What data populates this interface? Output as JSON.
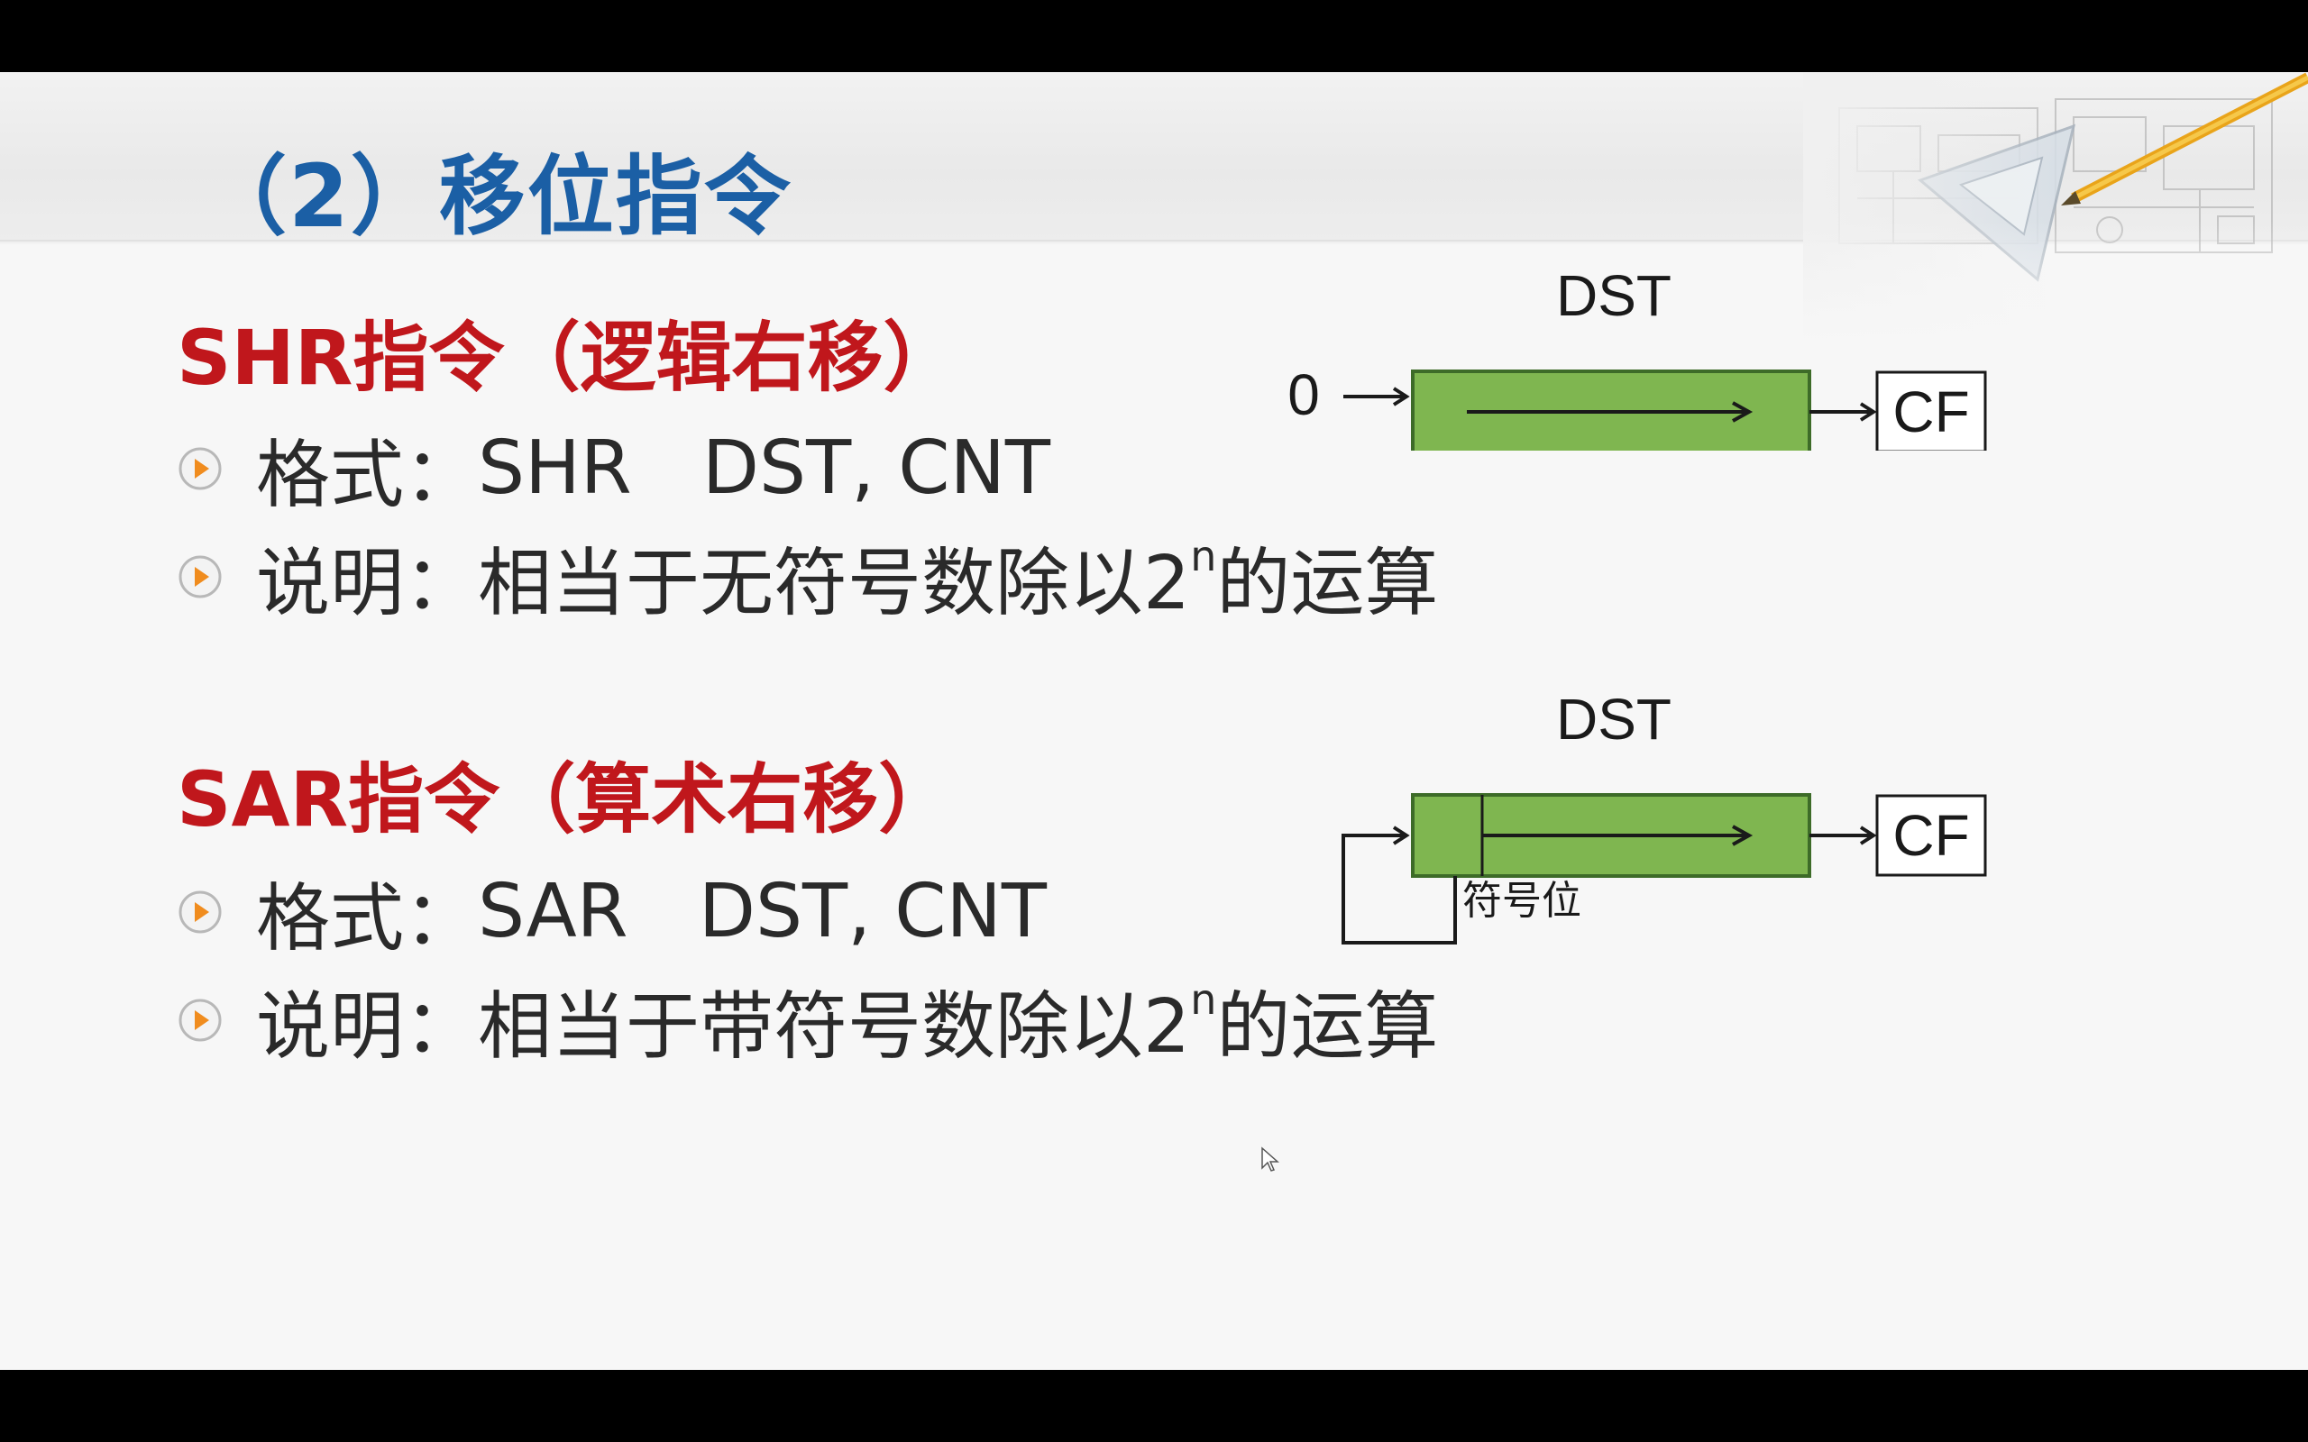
{
  "slide": {
    "title": "（2）移位指令",
    "sections": [
      {
        "heading": "SHR指令（逻辑右移）",
        "bullets": [
          {
            "label": "格式：",
            "text": "SHR   DST, CNT"
          },
          {
            "label": "说明：",
            "text": "相当于无符号数除以2",
            "sup": "n",
            "suffix": "的运算"
          }
        ],
        "diagram": {
          "register_label": "DST",
          "input_label": "0",
          "output_label": "CF"
        }
      },
      {
        "heading": "SAR指令（算术右移）",
        "bullets": [
          {
            "label": "格式：",
            "text": "SAR   DST, CNT"
          },
          {
            "label": "说明：",
            "text": "相当于带符号数除以2",
            "sup": "n",
            "suffix": "的运算"
          }
        ],
        "diagram": {
          "register_label": "DST",
          "output_label": "CF",
          "sign_bit_label": "符号位"
        }
      }
    ]
  },
  "colors": {
    "title": "#1b5fa5",
    "heading": "#c0171c",
    "register_fill": "#7fb650",
    "bullet_accent": "#f08c1e"
  },
  "icons": [
    "play-circle-bullet-icon",
    "pencil-icon",
    "triangle-ruler-icon",
    "mouse-cursor-icon"
  ]
}
